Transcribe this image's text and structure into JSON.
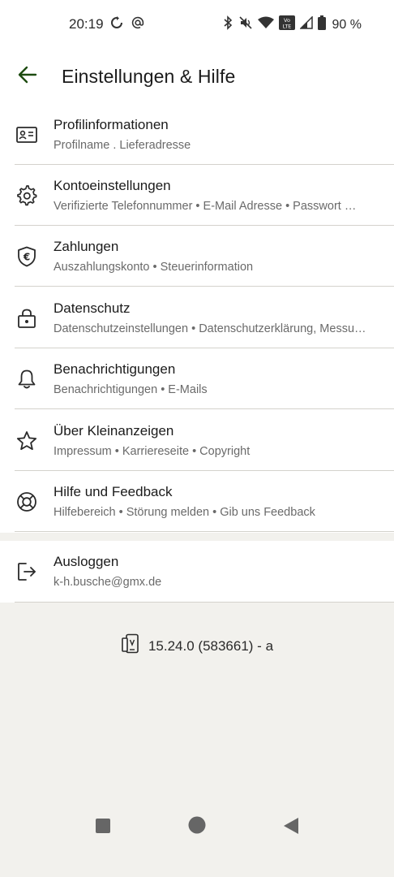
{
  "status": {
    "time": "20:19",
    "battery": "90 %"
  },
  "header": {
    "title": "Einstellungen & Hilfe"
  },
  "settings": [
    {
      "icon": "id-card-icon",
      "title": "Profilinformationen",
      "subtitle": "Profilname . Lieferadresse"
    },
    {
      "icon": "gear-icon",
      "title": "Kontoeinstellungen",
      "subtitle": "Verifizierte Telefonnummer  •  E-Mail Adresse  •  Passwort …"
    },
    {
      "icon": "euro-shield-icon",
      "title": "Zahlungen",
      "subtitle": "Auszahlungskonto  •  Steuerinformation"
    },
    {
      "icon": "lock-icon",
      "title": "Datenschutz",
      "subtitle": "Datenschutzeinstellungen  •  Datenschutzerklärung, Messu…"
    },
    {
      "icon": "bell-icon",
      "title": "Benachrichtigungen",
      "subtitle": "Benachrichtigungen  •  E-Mails"
    },
    {
      "icon": "star-icon",
      "title": "Über Kleinanzeigen",
      "subtitle": "Impressum  •  Karriereseite  •  Copyright"
    },
    {
      "icon": "lifebuoy-icon",
      "title": "Hilfe und Feedback",
      "subtitle": "Hilfebereich  •  Störung melden  •  Gib uns Feedback"
    }
  ],
  "logout": {
    "title": "Ausloggen",
    "email": "k-h.busche@gmx.de"
  },
  "version": "15.24.0 (583661) - a",
  "colors": {
    "accent": "#1d4b10",
    "page_background": "#f2f1ed",
    "divider": "#d4d2cc"
  }
}
